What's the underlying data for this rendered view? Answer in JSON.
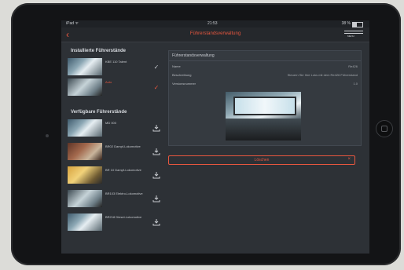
{
  "statusbar": {
    "carrier": "iPad ᯤ",
    "time": "21:53",
    "battery": "38 %",
    "battery_level": 0.38
  },
  "navbar": {
    "back_label": "‹",
    "title": "Führerstandsverwaltung",
    "menu_label": "MENU"
  },
  "installed": {
    "title": "Installierte Führerstände",
    "items": [
      {
        "label": "KBE 110 Talent",
        "active": false,
        "icon": "check-icon"
      },
      {
        "label": "Auto",
        "active": true,
        "icon": "check-icon"
      }
    ]
  },
  "available": {
    "title": "Verfügbare Führerstände",
    "items": [
      {
        "label": "MD 000",
        "icon": "download-icon"
      },
      {
        "label": "BR02 Dampf-Lokomotive",
        "icon": "download-icon"
      },
      {
        "label": "BR 10 Dampf-Lokomotive",
        "icon": "download-icon"
      },
      {
        "label": "BR103 Elektro-Lokomotive",
        "icon": "download-icon"
      },
      {
        "label": "BR218 Diesel-Lokomotive",
        "icon": "download-icon"
      }
    ]
  },
  "detail": {
    "title": "Führerstandsverwaltung",
    "props": [
      {
        "label": "Name",
        "value": "Re426"
      },
      {
        "label": "Beschreibung",
        "value": "Steuern Sie Ihre Loks mit dem Re426 Führerstand"
      },
      {
        "label": "Versionsnummer",
        "value": "1.0"
      }
    ],
    "delete_label": "Löschen",
    "delete_icon": "×"
  },
  "colors": {
    "accent": "#e8573f",
    "background": "#2d3136",
    "panel": "#353a40"
  }
}
